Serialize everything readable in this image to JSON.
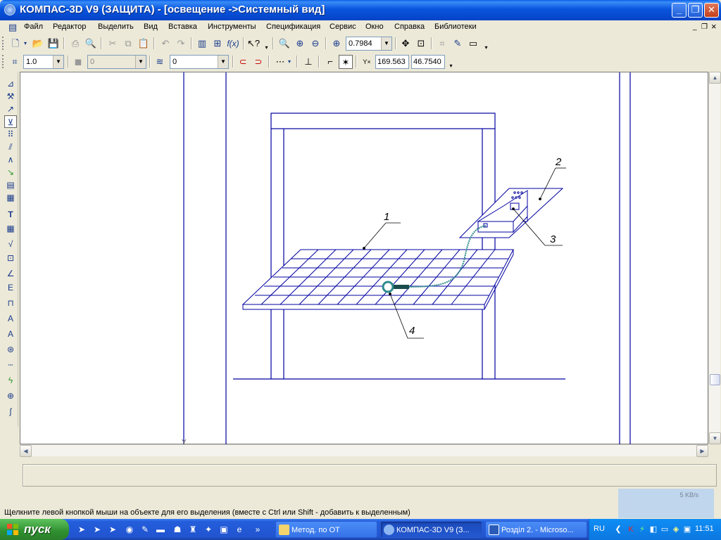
{
  "window": {
    "title": "КОМПАС-3D V9 (ЗАЩИТА) - [освещение ->Системный вид]",
    "min_label": "_",
    "max_label": "❐",
    "close_label": "✕"
  },
  "menu": {
    "items": [
      "Файл",
      "Редактор",
      "Выделить",
      "Вид",
      "Вставка",
      "Инструменты",
      "Спецификация",
      "Сервис",
      "Окно",
      "Справка",
      "Библиотеки"
    ],
    "mdi_min": "_",
    "mdi_restore": "❐",
    "mdi_close": "×"
  },
  "toolbar1": {
    "zoom_value": "0.7984"
  },
  "toolbar2": {
    "step_value": "1.0",
    "style_value": "0",
    "layer_value": "0",
    "coord_label": "Y×",
    "coord_x": "169.563",
    "coord_y": "46.7540"
  },
  "drawing": {
    "callouts": [
      "1",
      "2",
      "3",
      "4"
    ],
    "axis_mark": "Y"
  },
  "status": {
    "hint": "Щелкните левой кнопкой мыши на объекте для его выделения (вместе с Ctrl или Shift - добавить к выделенным)",
    "net_speed": "5 KB/s"
  },
  "taskbar": {
    "start_label": "пуск",
    "tasks": [
      "Метод. по ОТ",
      "КОМПАС-3D V9 (З...",
      "Розділ 2. - Microso..."
    ],
    "lang": "RU",
    "clock": "11:51"
  },
  "colors": {
    "drawing_line": "#0000a0",
    "cable": "#2e8b8b",
    "titlebar": "#0855dd"
  }
}
